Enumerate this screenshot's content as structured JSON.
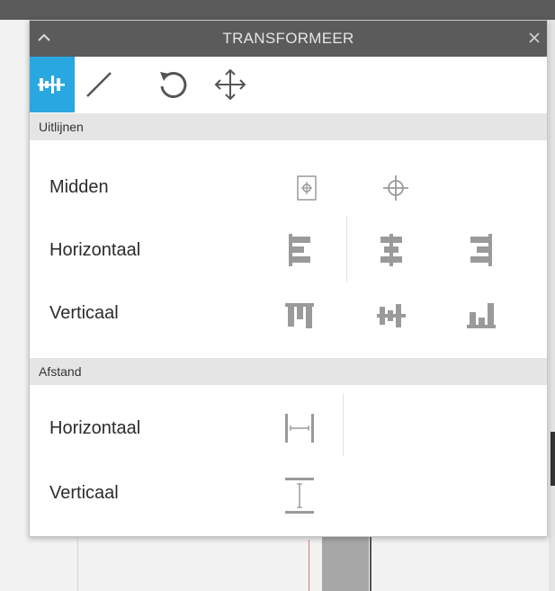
{
  "panel": {
    "title": "TRANSFORMEER"
  },
  "toolbar": {
    "tools": [
      {
        "icon": "align-tool-icon",
        "active": true
      },
      {
        "icon": "scale-tool-icon",
        "active": false
      },
      {
        "icon": "rotate-tool-icon",
        "active": false
      },
      {
        "icon": "move-tool-icon",
        "active": false
      }
    ]
  },
  "align_section": {
    "header": "Uitlijnen",
    "rows": [
      {
        "label": "Midden",
        "icons": [
          "center-to-page-icon",
          "center-icon"
        ]
      },
      {
        "label": "Horizontaal",
        "icons": [
          "align-left-icon",
          "align-center-icon",
          "align-right-icon"
        ]
      },
      {
        "label": "Verticaal",
        "icons": [
          "align-top-icon",
          "align-middle-icon",
          "align-bottom-icon"
        ]
      }
    ]
  },
  "spacing_section": {
    "header": "Afstand",
    "rows": [
      {
        "label": "Horizontaal",
        "icons": [
          "distribute-horizontal-icon"
        ]
      },
      {
        "label": "Verticaal",
        "icons": [
          "distribute-vertical-icon"
        ]
      }
    ]
  },
  "colors": {
    "accent": "#29a7e1",
    "titlebar": "#5b5b5b",
    "section_header": "#e5e5e5",
    "icon_gray": "#9a9a9a"
  }
}
